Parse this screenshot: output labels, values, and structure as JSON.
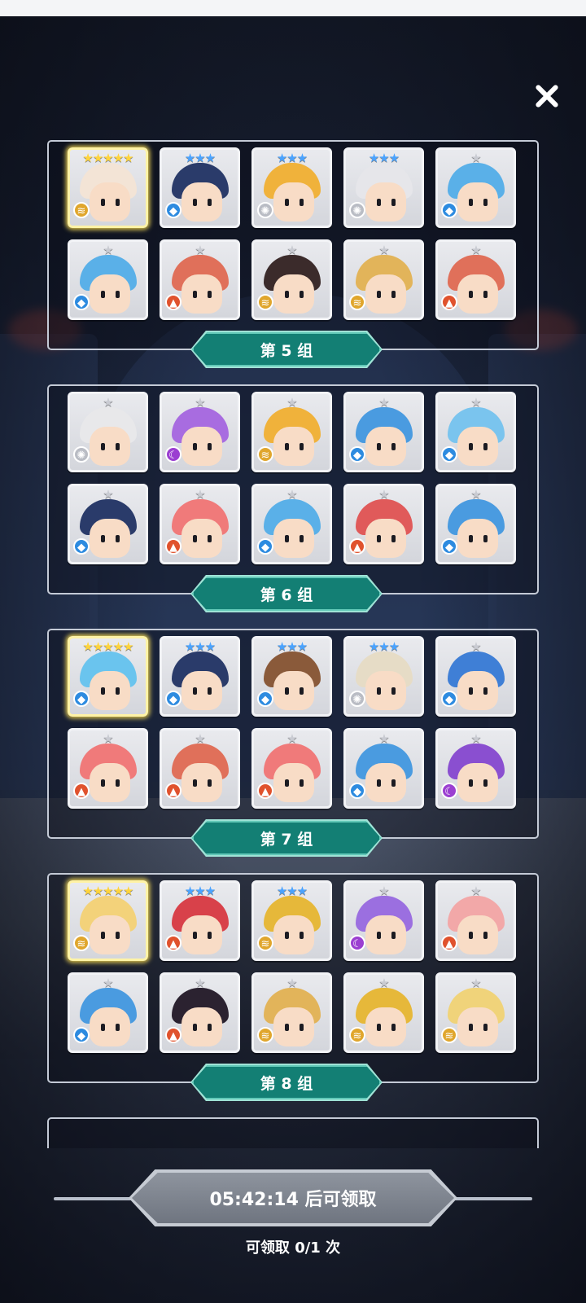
{
  "close_icon": "close-icon",
  "colors": {
    "ribbon": "#137f74",
    "ribbon_border": "#62c9b8",
    "star_gold": "#ffd43b",
    "star_blue": "#4aa3ff",
    "star_silver": "#c9cbd2",
    "claim_button": "#7f8590",
    "element_water": "#2d8be0",
    "element_fire": "#e0522d",
    "element_wind": "#e0a62d",
    "element_light": "#b9bcc4",
    "element_dark": "#9b3fd1"
  },
  "groups": [
    {
      "label": "第 5 组",
      "cards": [
        {
          "stars": 5,
          "element": "wind",
          "hair": "#f3e4d6"
        },
        {
          "stars": 3,
          "element": "water",
          "hair": "#2a3b6a"
        },
        {
          "stars": 3,
          "element": "light",
          "hair": "#f0b23b"
        },
        {
          "stars": 3,
          "element": "light",
          "hair": "#e6e6ea"
        },
        {
          "stars": 1,
          "element": "water",
          "hair": "#5ab0e8"
        },
        {
          "stars": 1,
          "element": "water",
          "hair": "#5ab0e8"
        },
        {
          "stars": 1,
          "element": "fire",
          "hair": "#e0705a"
        },
        {
          "stars": 1,
          "element": "wind",
          "hair": "#3b2b2b"
        },
        {
          "stars": 1,
          "element": "wind",
          "hair": "#e2b45a"
        },
        {
          "stars": 1,
          "element": "fire",
          "hair": "#e0705a"
        }
      ]
    },
    {
      "label": "第 6 组",
      "cards": [
        {
          "stars": 1,
          "element": "light",
          "hair": "#e8e8ea"
        },
        {
          "stars": 1,
          "element": "dark",
          "hair": "#a86ce0"
        },
        {
          "stars": 1,
          "element": "wind",
          "hair": "#f0b23b"
        },
        {
          "stars": 1,
          "element": "water",
          "hair": "#4a9be0"
        },
        {
          "stars": 1,
          "element": "water",
          "hair": "#7ac4ee"
        },
        {
          "stars": 1,
          "element": "water",
          "hair": "#2a3b6a"
        },
        {
          "stars": 1,
          "element": "fire",
          "hair": "#f07a7a"
        },
        {
          "stars": 1,
          "element": "water",
          "hair": "#5ab0e8"
        },
        {
          "stars": 1,
          "element": "fire",
          "hair": "#e05a5a"
        },
        {
          "stars": 1,
          "element": "water",
          "hair": "#4a9be0"
        }
      ]
    },
    {
      "label": "第 7 组",
      "cards": [
        {
          "stars": 5,
          "element": "water",
          "hair": "#6ac4ee"
        },
        {
          "stars": 3,
          "element": "water",
          "hair": "#2a3b6a"
        },
        {
          "stars": 3,
          "element": "water",
          "hair": "#8a5a3a"
        },
        {
          "stars": 3,
          "element": "light",
          "hair": "#e6dcc6"
        },
        {
          "stars": 1,
          "element": "water",
          "hair": "#3f7fd6"
        },
        {
          "stars": 1,
          "element": "fire",
          "hair": "#f07a7a"
        },
        {
          "stars": 1,
          "element": "fire",
          "hair": "#e0705a"
        },
        {
          "stars": 1,
          "element": "fire",
          "hair": "#f07a7a"
        },
        {
          "stars": 1,
          "element": "water",
          "hair": "#4a9be0"
        },
        {
          "stars": 1,
          "element": "dark",
          "hair": "#8a4fd0"
        }
      ]
    },
    {
      "label": "第 8 组",
      "cards": [
        {
          "stars": 5,
          "element": "wind",
          "hair": "#f3d27a"
        },
        {
          "stars": 3,
          "element": "fire",
          "hair": "#d8414a"
        },
        {
          "stars": 3,
          "element": "wind",
          "hair": "#e6b83a"
        },
        {
          "stars": 1,
          "element": "dark",
          "hair": "#9b6fe0"
        },
        {
          "stars": 1,
          "element": "fire",
          "hair": "#f2a8a8"
        },
        {
          "stars": 1,
          "element": "water",
          "hair": "#4a9be0"
        },
        {
          "stars": 1,
          "element": "fire",
          "hair": "#2b2230"
        },
        {
          "stars": 1,
          "element": "wind",
          "hair": "#e2b45a"
        },
        {
          "stars": 1,
          "element": "wind",
          "hair": "#e6b83a"
        },
        {
          "stars": 1,
          "element": "wind",
          "hair": "#f0d37a"
        }
      ]
    },
    {
      "label": "",
      "cards": []
    }
  ],
  "claim": {
    "button_label": "05:42:14 后可领取",
    "count_text": "可领取 0/1 次"
  }
}
